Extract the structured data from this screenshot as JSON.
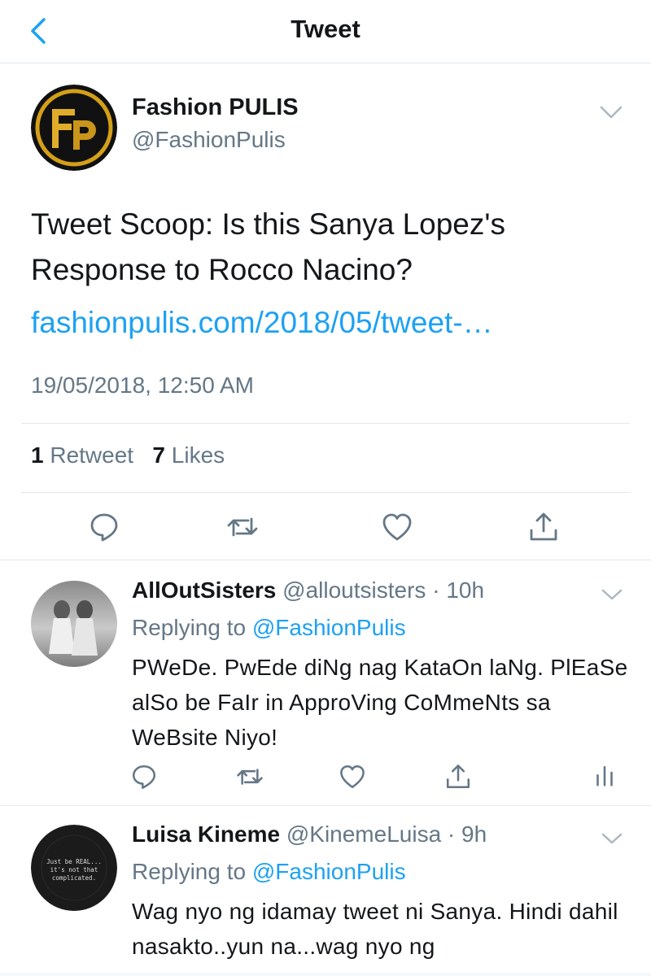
{
  "header": {
    "title": "Tweet"
  },
  "main_tweet": {
    "author_name": "Fashion PULIS",
    "author_handle": "@FashionPulis",
    "text": "Tweet Scoop: Is this Sanya Lopez's Response to Rocco Nacino?",
    "link": "fashionpulis.com/2018/05/tweet-…",
    "timestamp": "19/05/2018, 12:50 AM",
    "retweet_count": "1",
    "retweet_label": "Retweet",
    "like_count": "7",
    "like_label": "Likes"
  },
  "replies": [
    {
      "name": "AllOutSisters",
      "handle": "@alloutsisters",
      "time": "10h",
      "replying_label": "Replying to",
      "replying_to": "@FashionPulis",
      "text": "PWeDe. PwEde diNg nag KataOn laNg. PlEaSe alSo be FaIr in ApproVing CoMmeNts sa WeBsite Niyo!"
    },
    {
      "name": "Luisa Kineme",
      "handle": "@KinemeLuisa",
      "time": "9h",
      "replying_label": "Replying to",
      "replying_to": "@FashionPulis",
      "text": "Wag nyo ng idamay tweet ni Sanya. Hindi dahil nasakto..yun na...wag nyo ng",
      "avatar_text": "Just be REAL... it's not that complicated."
    }
  ],
  "colors": {
    "accent": "#1da1f2",
    "secondary_text": "#657786",
    "divider": "#e1e8ed",
    "logo_gold": "#d4a017"
  }
}
